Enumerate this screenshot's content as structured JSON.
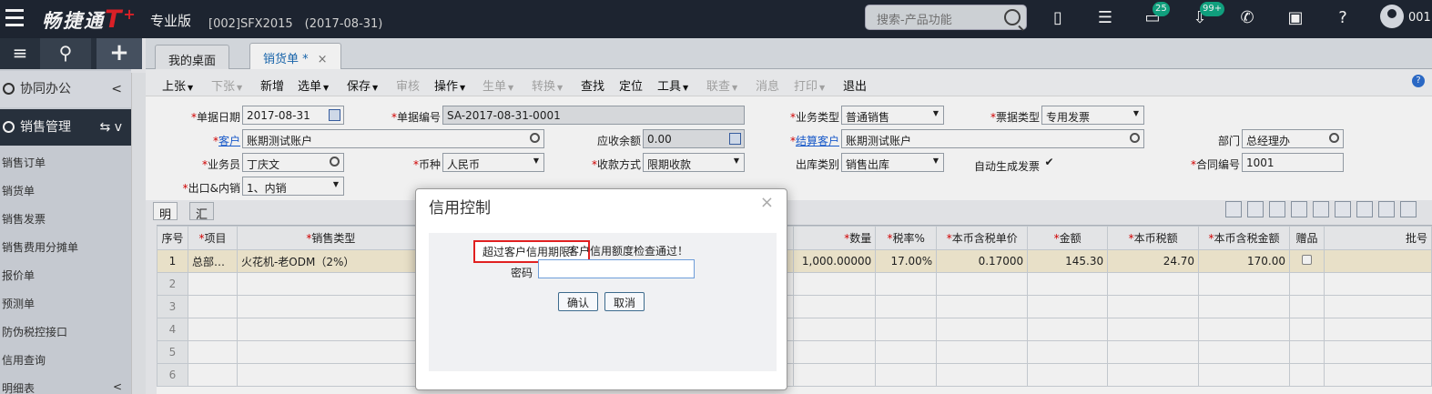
{
  "app": {
    "brand": "畅捷通",
    "brand_t": "T",
    "brand_plus": "+",
    "edition": "专业版",
    "account": "[002]SFX2015　(2017-08-31)",
    "search_placeholder": "搜索-产品功能",
    "badge_messages": "25",
    "badge_notifications": "99+",
    "user": "001"
  },
  "sidebar": {
    "group1": "协同办公",
    "group2": "销售管理",
    "items": [
      "销售订单",
      "销货单",
      "销售发票",
      "销售费用分摊单",
      "报价单",
      "预测单",
      "防伪税控接口",
      "信用查询",
      "明细表"
    ]
  },
  "tabs": [
    {
      "label": "我的桌面"
    },
    {
      "label": "销货单 *"
    }
  ],
  "toolbar": [
    "上张",
    "下张",
    "新增",
    "选单",
    "保存",
    "审核",
    "操作",
    "生单",
    "转换",
    "查找",
    "定位",
    "工具",
    "联查",
    "消息",
    "打印",
    "退出"
  ],
  "form": {
    "date_label": "单据日期",
    "date": "2017-08-31",
    "docno_label": "单据编号",
    "docno": "SA-2017-08-31-0001",
    "biztype_label": "业务类型",
    "biztype": "普通销售",
    "invtype_label": "票据类型",
    "invtype": "专用发票",
    "customer_label": "客户",
    "customer": "账期测试账户",
    "balance_label": "应收余额",
    "balance": "0.00",
    "settle_label": "结算客户",
    "settle": "账期测试账户",
    "dept_label": "部门",
    "dept": "总经理办",
    "clerk_label": "业务员",
    "clerk": "丁庆文",
    "currency_label": "币种",
    "currency": "人民币",
    "payment_label": "收款方式",
    "payment": "限期收款",
    "outtype_label": "出库类别",
    "outtype": "销售出库",
    "autoinv_label": "自动生成发票",
    "contract_label": "合同编号",
    "contract": "1001",
    "export_label": "出口&内销",
    "export": "1、内销"
  },
  "subtabs": [
    "明细",
    "汇总"
  ],
  "grid": {
    "headers": [
      "序号",
      "项目",
      "销售类型",
      "",
      "数量",
      "税率%",
      "本币含税单价",
      "金额",
      "本币税额",
      "本币含税金额",
      "赠品",
      "批号"
    ],
    "rows": [
      [
        "1",
        "总部…",
        "火花机-老ODM（2%）",
        "",
        "1,000.00000",
        "17.00%",
        "0.17000",
        "145.30",
        "24.70",
        "170.00",
        "",
        ""
      ],
      [
        "2",
        "",
        "",
        "",
        "",
        "",
        "",
        "",
        "",
        "",
        "",
        ""
      ],
      [
        "3",
        "",
        "",
        "",
        "",
        "",
        "",
        "",
        "",
        "",
        "",
        ""
      ],
      [
        "4",
        "",
        "",
        "",
        "",
        "",
        "",
        "",
        "",
        "",
        "",
        ""
      ],
      [
        "5",
        "",
        "",
        "",
        "",
        "",
        "",
        "",
        "",
        "",
        "",
        ""
      ],
      [
        "6",
        "",
        "",
        "",
        "",
        "",
        "",
        "",
        "",
        "",
        "",
        ""
      ]
    ]
  },
  "dialog": {
    "title": "信用控制",
    "close": "×",
    "warning": "超过客户信用期限！",
    "message": "客户信用额度检查通过！",
    "password_label": "密码",
    "ok": "确认",
    "cancel": "取消"
  }
}
